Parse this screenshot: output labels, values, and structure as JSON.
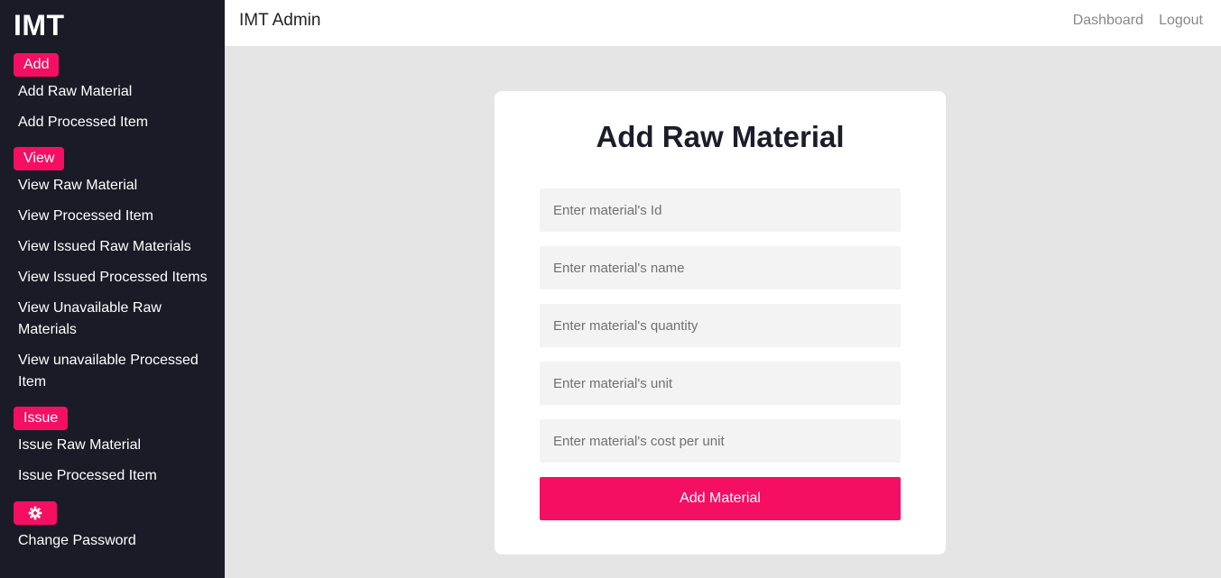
{
  "sidebar": {
    "brand": "IMT",
    "sections": [
      {
        "badge": "Add",
        "items": [
          "Add Raw Material",
          "Add Processed Item"
        ]
      },
      {
        "badge": "View",
        "items": [
          "View Raw Material",
          "View Processed Item",
          "View Issued Raw Materials",
          "View Issued Processed Items",
          "View Unavailable Raw Materials",
          "View unavailable Processed Item"
        ]
      },
      {
        "badge": "Issue",
        "items": [
          "Issue Raw Material",
          "Issue Processed Item"
        ]
      },
      {
        "badge_icon": "gear-icon",
        "items": [
          "Change Password"
        ]
      }
    ]
  },
  "topbar": {
    "title": "IMT Admin",
    "nav": [
      "Dashboard",
      "Logout"
    ]
  },
  "form": {
    "title": "Add Raw Material",
    "fields": [
      {
        "placeholder": "Enter material's Id",
        "value": ""
      },
      {
        "placeholder": "Enter material's name",
        "value": ""
      },
      {
        "placeholder": "Enter material's quantity",
        "value": ""
      },
      {
        "placeholder": "Enter material's unit",
        "value": ""
      },
      {
        "placeholder": "Enter material's cost per unit",
        "value": ""
      }
    ],
    "submit_label": "Add Material"
  },
  "colors": {
    "sidebar_bg": "#1b1b27",
    "accent": "#f50f62",
    "page_bg": "#e5e5e5"
  }
}
